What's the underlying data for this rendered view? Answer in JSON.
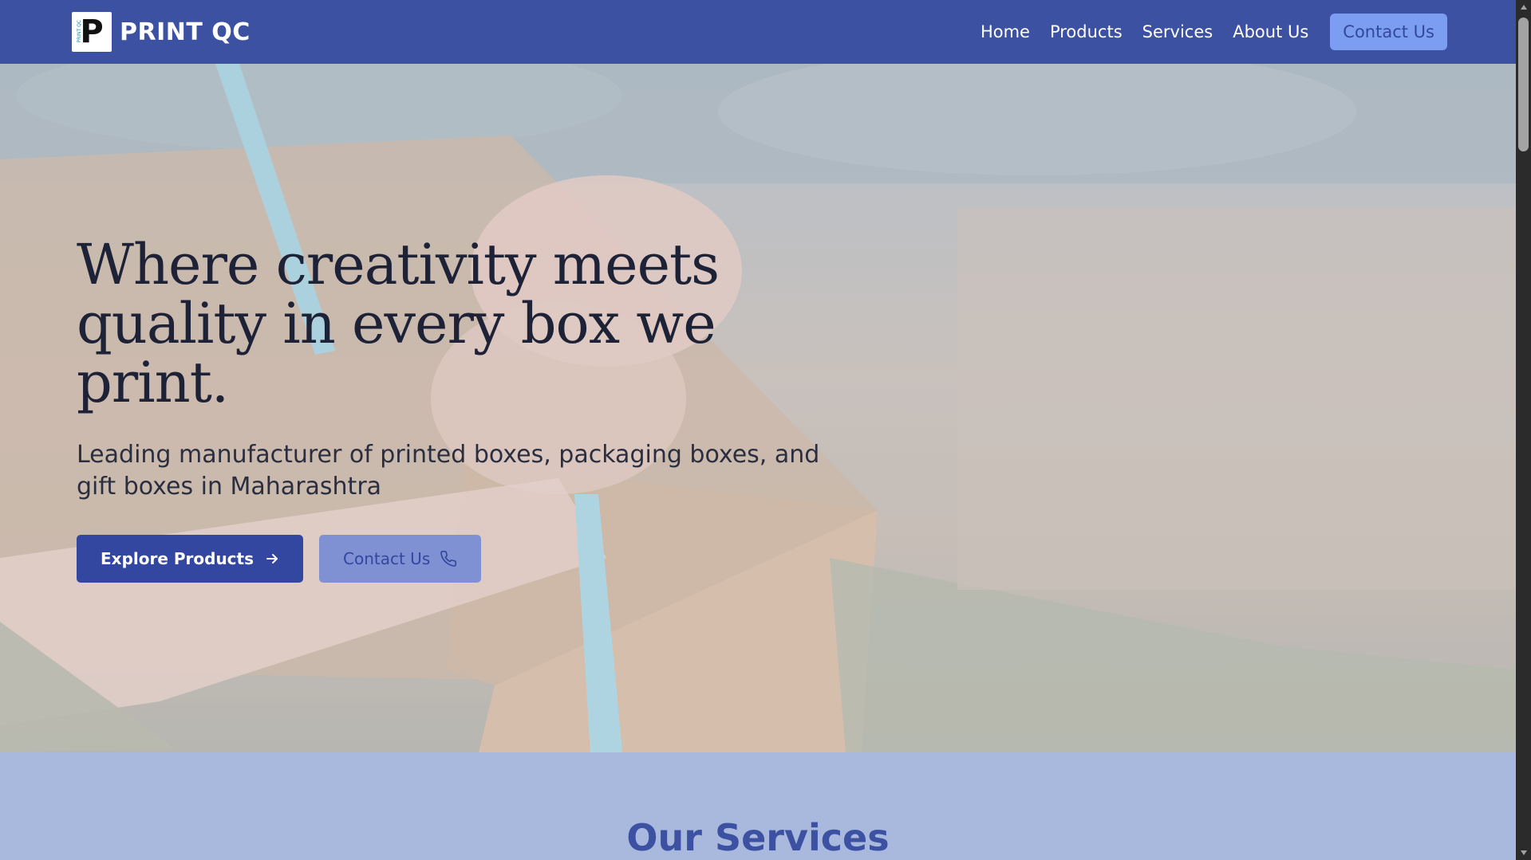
{
  "brand": {
    "name": "PRINT QC",
    "logo_letter": "P",
    "logo_tiny_text": "PRINT QC"
  },
  "nav": {
    "links": [
      "Home",
      "Products",
      "Services",
      "About Us"
    ],
    "cta_label": "Contact Us"
  },
  "hero": {
    "title": "Where creativity meets quality in every box we print.",
    "subtitle": "Leading manufacturer of printed boxes, packaging boxes, and gift boxes in Maharashtra",
    "primary_button": "Explore Products",
    "secondary_button": "Contact Us",
    "icons": {
      "primary": "arrow-right-icon",
      "secondary": "phone-icon"
    }
  },
  "services": {
    "title": "Our Services"
  },
  "colors": {
    "nav_bg": "#3d51a3",
    "primary": "#3347a0",
    "secondary_btn": "#8091d3",
    "nav_cta_bg": "#7b9ef2",
    "services_bg": "#a9b8dd",
    "hero_text": "#1e2236"
  }
}
